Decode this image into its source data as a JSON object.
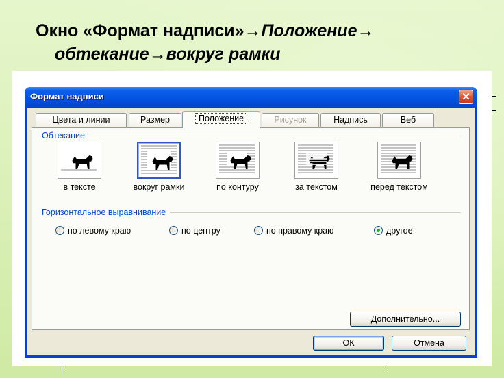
{
  "heading": {
    "line1_plain": "Окно «Формат надписи»",
    "line1_arrow1": "→",
    "line1_italic": "Положение",
    "line1_arrow2": "→",
    "line2_part1": "обтекание",
    "line2_arrow": "→",
    "line2_part2": "вокруг рамки"
  },
  "dialog": {
    "title": "Формат надписи",
    "close_glyph": "✕",
    "tabs": [
      {
        "label": "Цвета и линии",
        "state": "normal"
      },
      {
        "label": "Размер",
        "state": "normal"
      },
      {
        "label": "Положение",
        "state": "active"
      },
      {
        "label": "Рисунок",
        "state": "disabled"
      },
      {
        "label": "Надпись",
        "state": "normal"
      },
      {
        "label": "Веб",
        "state": "normal"
      }
    ],
    "wrapping": {
      "group_label": "Обтекание",
      "options": [
        {
          "label": "в тексте",
          "icon": "wrap-inline-icon",
          "selected": false
        },
        {
          "label": "вокруг рамки",
          "icon": "wrap-square-icon",
          "selected": true
        },
        {
          "label": "по контуру",
          "icon": "wrap-tight-icon",
          "selected": false
        },
        {
          "label": "за текстом",
          "icon": "wrap-behind-text-icon",
          "selected": false
        },
        {
          "label": "перед текстом",
          "icon": "wrap-in-front-icon",
          "selected": false
        }
      ]
    },
    "horizontal_alignment": {
      "group_label": "Горизонтальное выравнивание",
      "options": [
        {
          "label": "по левому краю",
          "checked": false
        },
        {
          "label": "по центру",
          "checked": false
        },
        {
          "label": "по правому краю",
          "checked": false
        },
        {
          "label": "другое",
          "checked": true
        }
      ]
    },
    "advanced_button": "Дополнительно...",
    "ok_button": "ОК",
    "cancel_button": "Отмена"
  },
  "colors": {
    "title_bar": "#0352e0",
    "close_button": "#e0522e",
    "dialog_face": "#ece9d8",
    "group_label": "#0046d5",
    "active_tab_accent": "#f0a22c",
    "background": "#d8f0b4"
  }
}
